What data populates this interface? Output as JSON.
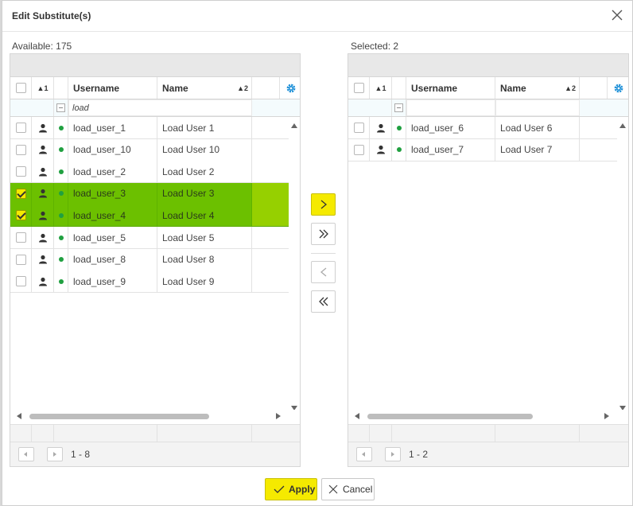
{
  "dialog": {
    "title": "Edit Substitute(s)"
  },
  "available": {
    "caption": "Available: 175",
    "columns": {
      "sort1": "▲1",
      "username": "Username",
      "name": "Name",
      "name_sort": "▲2"
    },
    "filter_value": "load",
    "rows": [
      {
        "username": "load_user_1",
        "name": "Load User 1",
        "checked": false
      },
      {
        "username": "load_user_10",
        "name": "Load User 10",
        "checked": false
      },
      {
        "username": "load_user_2",
        "name": "Load User 2",
        "checked": false
      },
      {
        "username": "load_user_3",
        "name": "Load User 3",
        "checked": true
      },
      {
        "username": "load_user_4",
        "name": "Load User 4",
        "checked": true
      },
      {
        "username": "load_user_5",
        "name": "Load User 5",
        "checked": false
      },
      {
        "username": "load_user_8",
        "name": "Load User 8",
        "checked": false
      },
      {
        "username": "load_user_9",
        "name": "Load User 9",
        "checked": false
      }
    ],
    "pager": "1 - 8"
  },
  "selected": {
    "caption": "Selected: 2",
    "columns": {
      "sort1": "▲1",
      "username": "Username",
      "name": "Name",
      "name_sort": "▲2"
    },
    "rows": [
      {
        "username": "load_user_6",
        "name": "Load User 6",
        "checked": false
      },
      {
        "username": "load_user_7",
        "name": "Load User 7",
        "checked": false
      }
    ],
    "pager": "1 - 2"
  },
  "buttons": {
    "apply": "Apply",
    "cancel": "Cancel"
  },
  "colors": {
    "selection": "#6cc000",
    "highlight": "#f5ea00",
    "status_dot": "#20a040",
    "gear": "#1e90d8"
  }
}
